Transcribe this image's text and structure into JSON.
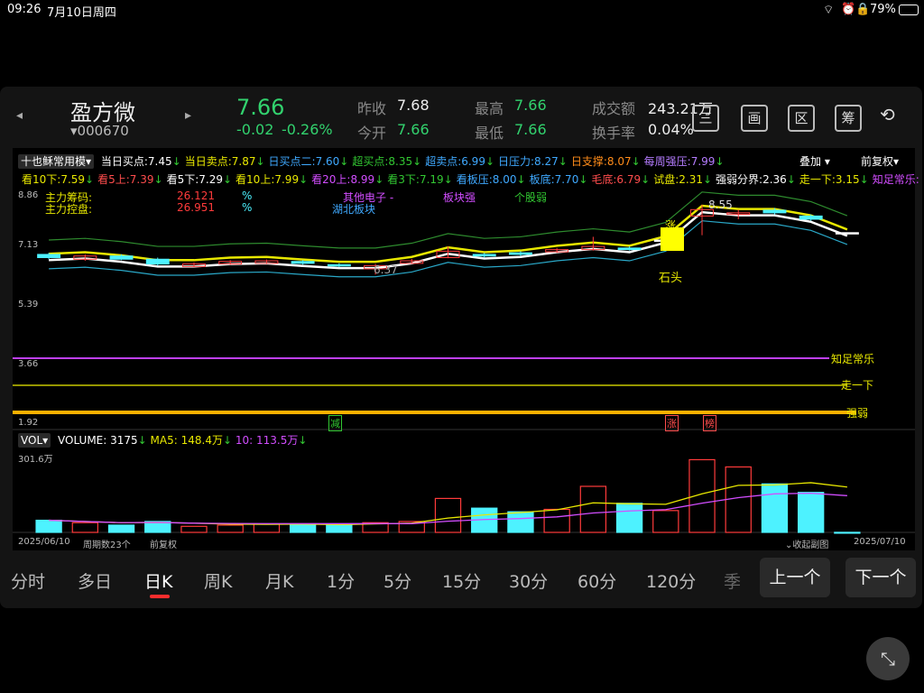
{
  "status": {
    "time": "09:26",
    "date": "7月10日周四",
    "battery": "79%"
  },
  "header": {
    "name": "盈方微",
    "code": "000670",
    "price": "7.66",
    "change": "-0.02",
    "change_pct": "-0.26%",
    "prev_close_label": "昨收",
    "prev_close": "7.68",
    "open_label": "今开",
    "open": "7.66",
    "high_label": "最高",
    "high": "7.66",
    "low_label": "最低",
    "low": "7.66",
    "turnover_label": "成交额",
    "turnover": "243.21万",
    "turnover_rate_label": "换手率",
    "turnover_rate": "0.04%",
    "icons": [
      "三",
      "画",
      "区",
      "筹"
    ]
  },
  "indicators": {
    "template": "十也稣常用模",
    "overlay_label": "叠加",
    "adjust_label": "前复权",
    "row1": [
      {
        "text": "当日买点:7.45",
        "color": "#ffffff"
      },
      {
        "text": "当日卖点:7.87",
        "color": "#e8e800"
      },
      {
        "text": "日买点二:7.60",
        "color": "#3fa9ff"
      },
      {
        "text": "超买点:8.35",
        "color": "#32c832"
      },
      {
        "text": "超卖点:6.99",
        "color": "#3fa9ff"
      },
      {
        "text": "日压力:8.27",
        "color": "#3fa9ff"
      },
      {
        "text": "日支撑:8.07",
        "color": "#ff8c1a"
      },
      {
        "text": "每周强压:7.99",
        "color": "#b57cff"
      }
    ],
    "row2": [
      {
        "text": "看10下:7.59",
        "color": "#e8e800"
      },
      {
        "text": "看5上:7.39",
        "color": "#ff4d4d"
      },
      {
        "text": "看5下:7.29",
        "color": "#ffffff"
      },
      {
        "text": "看10上:7.99",
        "color": "#e8e800"
      },
      {
        "text": "看20上:8.99",
        "color": "#d24dff"
      },
      {
        "text": "看3下:7.19",
        "color": "#32c832"
      },
      {
        "text": "看板压:8.00",
        "color": "#3fa9ff"
      },
      {
        "text": "板底:7.70",
        "color": "#3fa9ff"
      },
      {
        "text": "毛底:6.79",
        "color": "#ff4d4d"
      },
      {
        "text": "试盘:2.31",
        "color": "#e8e800"
      },
      {
        "text": "强弱分界:2.36",
        "color": "#ffffff"
      },
      {
        "text": "走一下:3.15",
        "color": "#e8e800"
      },
      {
        "text": "知足常乐:",
        "color": "#d24dff"
      }
    ],
    "chip_label": "主力筹码:",
    "chip_val": "26.121",
    "control_label": "主力控盘:",
    "control_val": "26.951",
    "pct1": "%",
    "pct2": "%",
    "sector1": "其他电子 -",
    "sector2": "湖北板块",
    "strong": "板块强",
    "weak": "个股弱"
  },
  "price_axis": {
    "t1": "8.86",
    "t2": "7.13",
    "t3": "5.39",
    "t4": "3.66",
    "t5": "1.92"
  },
  "markers": {
    "peak": "8.55",
    "low": "6.37",
    "stone": "石头",
    "zhang": "涨",
    "zhangb": "涨",
    "bang": "榜",
    "jian": "减"
  },
  "line_labels": {
    "a": "知足常乐",
    "b": "走一下",
    "c": "强弱"
  },
  "volume": {
    "selector": "VOL",
    "volume_label": "VOLUME: 3175",
    "ma5_label": "MA5: 148.4万",
    "ma10_label": "10: 113.5万",
    "scale": "301.6万"
  },
  "footer": {
    "start": "2025/06/10",
    "period": "周期数23个",
    "adjust": "前复权",
    "collapse": "收起副图",
    "end": "2025/07/10"
  },
  "tabs": [
    "分时",
    "多日",
    "日K",
    "周K",
    "月K",
    "1分",
    "5分",
    "15分",
    "30分",
    "60分",
    "120分",
    "季"
  ],
  "nav": {
    "prev": "上一个",
    "next": "下一个"
  },
  "colors": {
    "up": "#ff3b3b",
    "down": "#32d26e",
    "cyan": "#4df2ff",
    "yellow": "#e8e800"
  },
  "chart_data": {
    "type": "candlestick",
    "x_start": "2025/06/10",
    "x_end": "2025/07/10",
    "ylim": [
      1.92,
      8.86
    ],
    "candles": [
      {
        "o": 7.0,
        "c": 6.9,
        "h": 7.05,
        "l": 6.85,
        "dir": "down"
      },
      {
        "o": 6.85,
        "c": 6.95,
        "h": 7.0,
        "l": 6.8,
        "dir": "up"
      },
      {
        "o": 6.95,
        "c": 6.85,
        "h": 7.0,
        "l": 6.82,
        "dir": "down"
      },
      {
        "o": 6.85,
        "c": 6.7,
        "h": 6.9,
        "l": 6.65,
        "dir": "down"
      },
      {
        "o": 6.62,
        "c": 6.7,
        "h": 6.75,
        "l": 6.6,
        "dir": "up"
      },
      {
        "o": 6.7,
        "c": 6.78,
        "h": 6.82,
        "l": 6.68,
        "dir": "up"
      },
      {
        "o": 6.72,
        "c": 6.8,
        "h": 6.84,
        "l": 6.7,
        "dir": "up"
      },
      {
        "o": 6.78,
        "c": 6.72,
        "h": 6.82,
        "l": 6.68,
        "dir": "down"
      },
      {
        "o": 6.68,
        "c": 6.65,
        "h": 6.72,
        "l": 6.6,
        "dir": "down"
      },
      {
        "o": 6.55,
        "c": 6.65,
        "h": 6.7,
        "l": 6.37,
        "dir": "up"
      },
      {
        "o": 6.72,
        "c": 6.8,
        "h": 6.86,
        "l": 6.7,
        "dir": "up"
      },
      {
        "o": 6.9,
        "c": 7.1,
        "h": 7.25,
        "l": 6.88,
        "dir": "up"
      },
      {
        "o": 7.0,
        "c": 6.95,
        "h": 7.05,
        "l": 6.9,
        "dir": "down"
      },
      {
        "o": 7.05,
        "c": 7.0,
        "h": 7.1,
        "l": 6.95,
        "dir": "down"
      },
      {
        "o": 7.08,
        "c": 7.15,
        "h": 7.2,
        "l": 7.05,
        "dir": "up"
      },
      {
        "o": 7.15,
        "c": 7.25,
        "h": 7.55,
        "l": 7.12,
        "dir": "up"
      },
      {
        "o": 7.2,
        "c": 7.15,
        "h": 7.25,
        "l": 7.12,
        "dir": "down"
      },
      {
        "o": 7.45,
        "c": 7.45,
        "h": 7.45,
        "l": 7.45,
        "dir": "flat"
      },
      {
        "o": 8.2,
        "c": 8.4,
        "h": 8.55,
        "l": 7.6,
        "dir": "up"
      },
      {
        "o": 8.25,
        "c": 8.3,
        "h": 8.4,
        "l": 8.1,
        "dir": "up"
      },
      {
        "o": 8.38,
        "c": 8.3,
        "h": 8.45,
        "l": 8.25,
        "dir": "down"
      },
      {
        "o": 8.2,
        "c": 8.1,
        "h": 8.25,
        "l": 8.05,
        "dir": "down"
      },
      {
        "o": 7.68,
        "c": 7.66,
        "h": 7.68,
        "l": 7.66,
        "dir": "flat"
      }
    ],
    "vol_scale": 301.6,
    "volume": [
      {
        "v": 50,
        "dir": "down"
      },
      {
        "v": 40,
        "dir": "up"
      },
      {
        "v": 30,
        "dir": "down"
      },
      {
        "v": 45,
        "dir": "down"
      },
      {
        "v": 25,
        "dir": "up"
      },
      {
        "v": 30,
        "dir": "up"
      },
      {
        "v": 35,
        "dir": "up"
      },
      {
        "v": 35,
        "dir": "down"
      },
      {
        "v": 35,
        "dir": "down"
      },
      {
        "v": 40,
        "dir": "up"
      },
      {
        "v": 45,
        "dir": "up"
      },
      {
        "v": 140,
        "dir": "up"
      },
      {
        "v": 100,
        "dir": "down"
      },
      {
        "v": 85,
        "dir": "down"
      },
      {
        "v": 95,
        "dir": "up"
      },
      {
        "v": 190,
        "dir": "up"
      },
      {
        "v": 120,
        "dir": "down"
      },
      {
        "v": 90,
        "dir": "up"
      },
      {
        "v": 300,
        "dir": "up"
      },
      {
        "v": 270,
        "dir": "up"
      },
      {
        "v": 200,
        "dir": "down"
      },
      {
        "v": 165,
        "dir": "down"
      },
      {
        "v": 0.3,
        "dir": "down"
      }
    ]
  }
}
